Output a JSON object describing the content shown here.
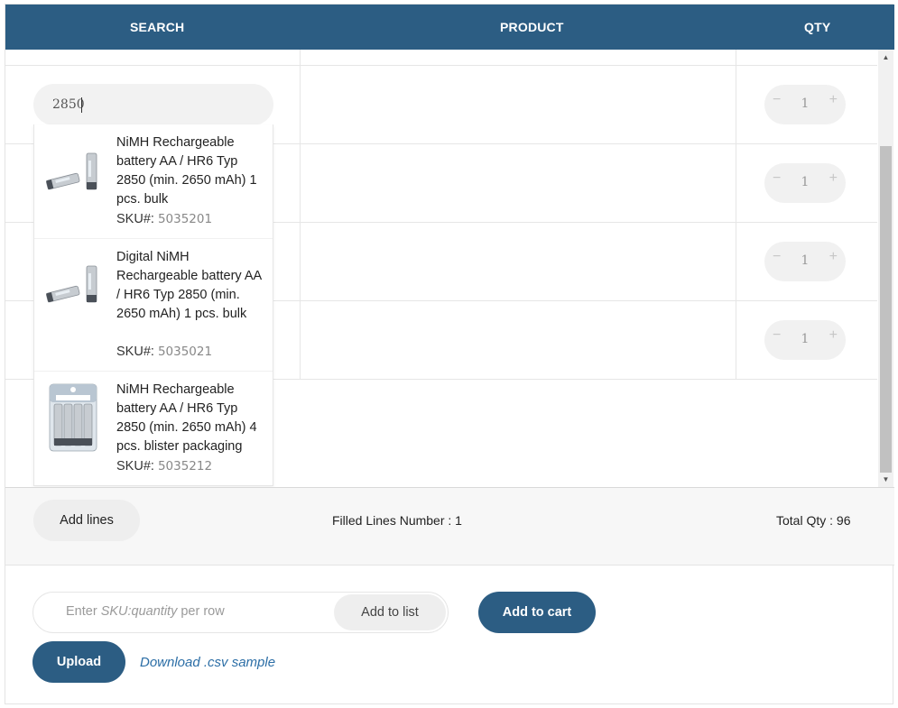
{
  "table": {
    "headers": {
      "search": "SEARCH",
      "product": "PRODUCT",
      "qty": "QTY"
    },
    "rows": [
      {
        "qty": "1"
      },
      {
        "qty": "1"
      },
      {
        "qty": "1"
      },
      {
        "qty": "1"
      }
    ]
  },
  "search": {
    "value": "2850"
  },
  "suggestions": [
    {
      "name": "NiMH Rechargeable battery AA / HR6 Typ 2850 (min. 2650 mAh) 1 pcs. bulk",
      "sku_label": "SKU#:",
      "sku": "5035201",
      "image": "single-battery"
    },
    {
      "name": "Digital NiMH Rechargeable battery AA / HR6 Typ 2850 (min. 2650 mAh) 1 pcs. bulk",
      "sku_label": "SKU#:",
      "sku": "5035021",
      "image": "single-battery"
    },
    {
      "name": "NiMH Rechargeable battery AA / HR6 Typ 2850 (min. 2650 mAh) 4 pcs. blister packaging",
      "sku_label": "SKU#:",
      "sku": "5035212",
      "image": "blister-pack"
    }
  ],
  "summary": {
    "add_lines": "Add lines",
    "filled_lines": "Filled Lines Number : 1",
    "total_qty": "Total Qty : 96"
  },
  "quick_add": {
    "placeholder_prefix": "Enter ",
    "placeholder_italic": "SKU:quantity",
    "placeholder_suffix": " per row",
    "add_to_list": "Add to list",
    "add_to_cart": "Add to cart",
    "upload": "Upload",
    "csv_link": "Download .csv sample"
  },
  "colors": {
    "primary": "#2c5d83",
    "link": "#2c6ea6"
  }
}
